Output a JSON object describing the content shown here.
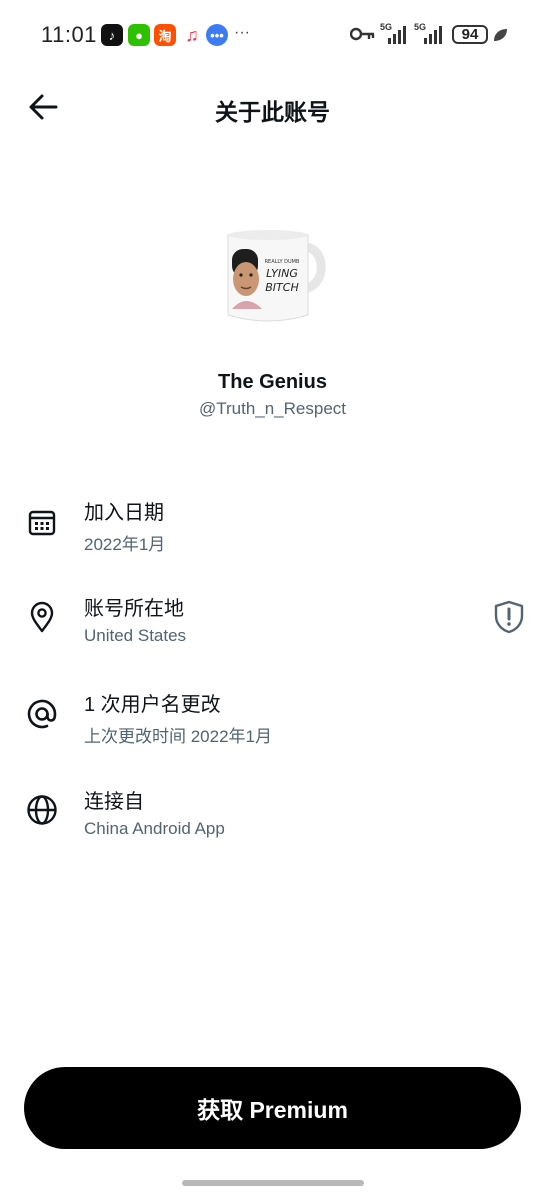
{
  "status_bar": {
    "time": "11:01",
    "apps": [
      "tiktok-icon",
      "wechat-icon",
      "taobao-icon",
      "music-icon",
      "messages-icon"
    ],
    "more": "···",
    "sim1": "5G",
    "sim2": "5G",
    "battery": "94"
  },
  "header": {
    "title": "关于此账号",
    "back_icon": "arrow-left-icon"
  },
  "profile": {
    "display_name": "The Genius",
    "handle": "@Truth_n_Respect",
    "mug_text_small": "REALLY DUMB",
    "mug_text_line1": "LYING",
    "mug_text_line2": "BITCH"
  },
  "info": {
    "joined": {
      "icon": "calendar-icon",
      "title": "加入日期",
      "value": "2022年1月"
    },
    "location": {
      "icon": "location-pin-icon",
      "title": "账号所在地",
      "value": "United States",
      "badge_icon": "shield-alert-icon"
    },
    "username_changes": {
      "icon": "at-sign-icon",
      "title": "1 次用户名更改",
      "value": "上次更改时间 2022年1月"
    },
    "connected_via": {
      "icon": "globe-icon",
      "title": "连接自",
      "value": "China Android App"
    }
  },
  "cta": {
    "label": "获取 Premium"
  },
  "colors": {
    "primary_text": "#0f1419",
    "secondary_text": "#536471",
    "button_bg": "#000000",
    "background": "#ffffff"
  }
}
